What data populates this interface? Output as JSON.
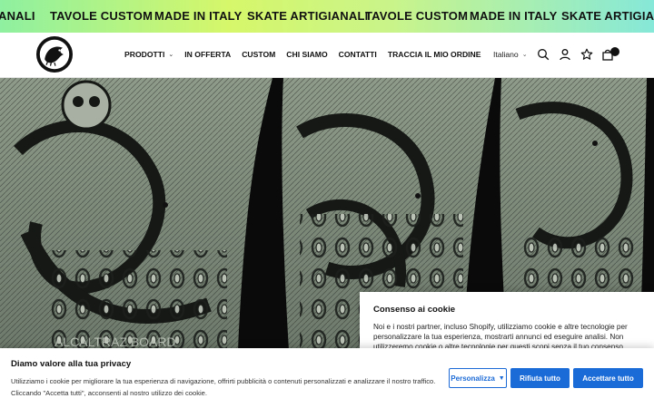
{
  "marquee": {
    "items": [
      "ANALI",
      "TAVOLE CUSTOM",
      "MADE IN ITALY",
      "SKATE ARTIGIANALI",
      "TAVOLE CUSTOM",
      "MADE IN ITALY",
      "SKATE ARTIGIANALI"
    ]
  },
  "nav": {
    "items": [
      "PRODOTTI",
      "IN OFFERTA",
      "CUSTOM",
      "CHI SIAMO",
      "CONTATTI",
      "TRACCIA IL MIO ORDINE"
    ],
    "language": "Italiano"
  },
  "icons": {
    "dropdown": "chevron-down-icon",
    "search": "search-icon",
    "account": "user-icon",
    "wishlist": "star-icon",
    "cart": "bag-icon",
    "next": "arrow-right-icon"
  },
  "hero": {
    "board_text": "ALCALTRAZ BOARD"
  },
  "consent": {
    "title": "Consenso ai cookie",
    "text": "Noi e i nostri partner, incluso Shopify, utilizziamo cookie e altre tecnologie per personalizzare la tua esperienza, mostrarti annunci ed eseguire analisi. Non utilizzeremo cookie o altre tecnologie per questi scopi senza il tuo consenso."
  },
  "privacy": {
    "title": "Diamo valore alla tua privacy",
    "text": "Utilizziamo i cookie per migliorare la tua esperienza di navigazione, offrirti pubblicità o contenuti personalizzati e analizzare il nostro traffico. Cliccando \"Accetta tutti\", acconsenti al nostro utilizzo dei cookie.",
    "customize_label": "Personalizza",
    "reject_label": "Rifiuta tutto",
    "accept_label": "Accettare tutto"
  },
  "colors": {
    "accent_blue": "#1a6bd8",
    "marquee_green": "#c9f48a"
  }
}
